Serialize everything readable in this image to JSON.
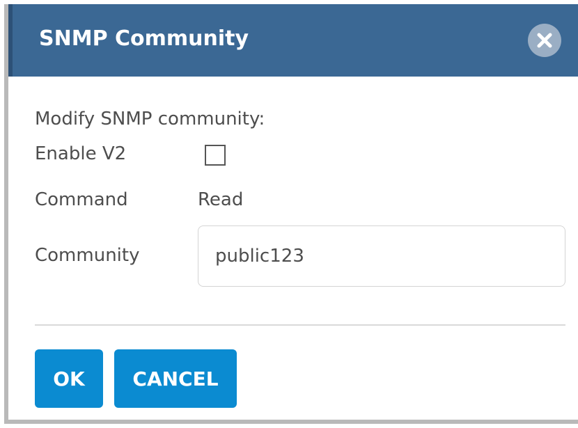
{
  "dialog": {
    "title": "SNMP Community",
    "close_icon": "close-x-icon",
    "description": "Modify SNMP community:",
    "enable_v2": {
      "label": "Enable V2",
      "checked": false
    },
    "command": {
      "label": "Command",
      "value": "Read"
    },
    "community": {
      "label": "Community",
      "value": "public123"
    },
    "buttons": {
      "ok": "OK",
      "cancel": "CANCEL"
    }
  },
  "colors": {
    "title_bar": "#3b6894",
    "button": "#0b8bd1",
    "close_button": "#9aaec4",
    "text": "#4d4d4d"
  }
}
